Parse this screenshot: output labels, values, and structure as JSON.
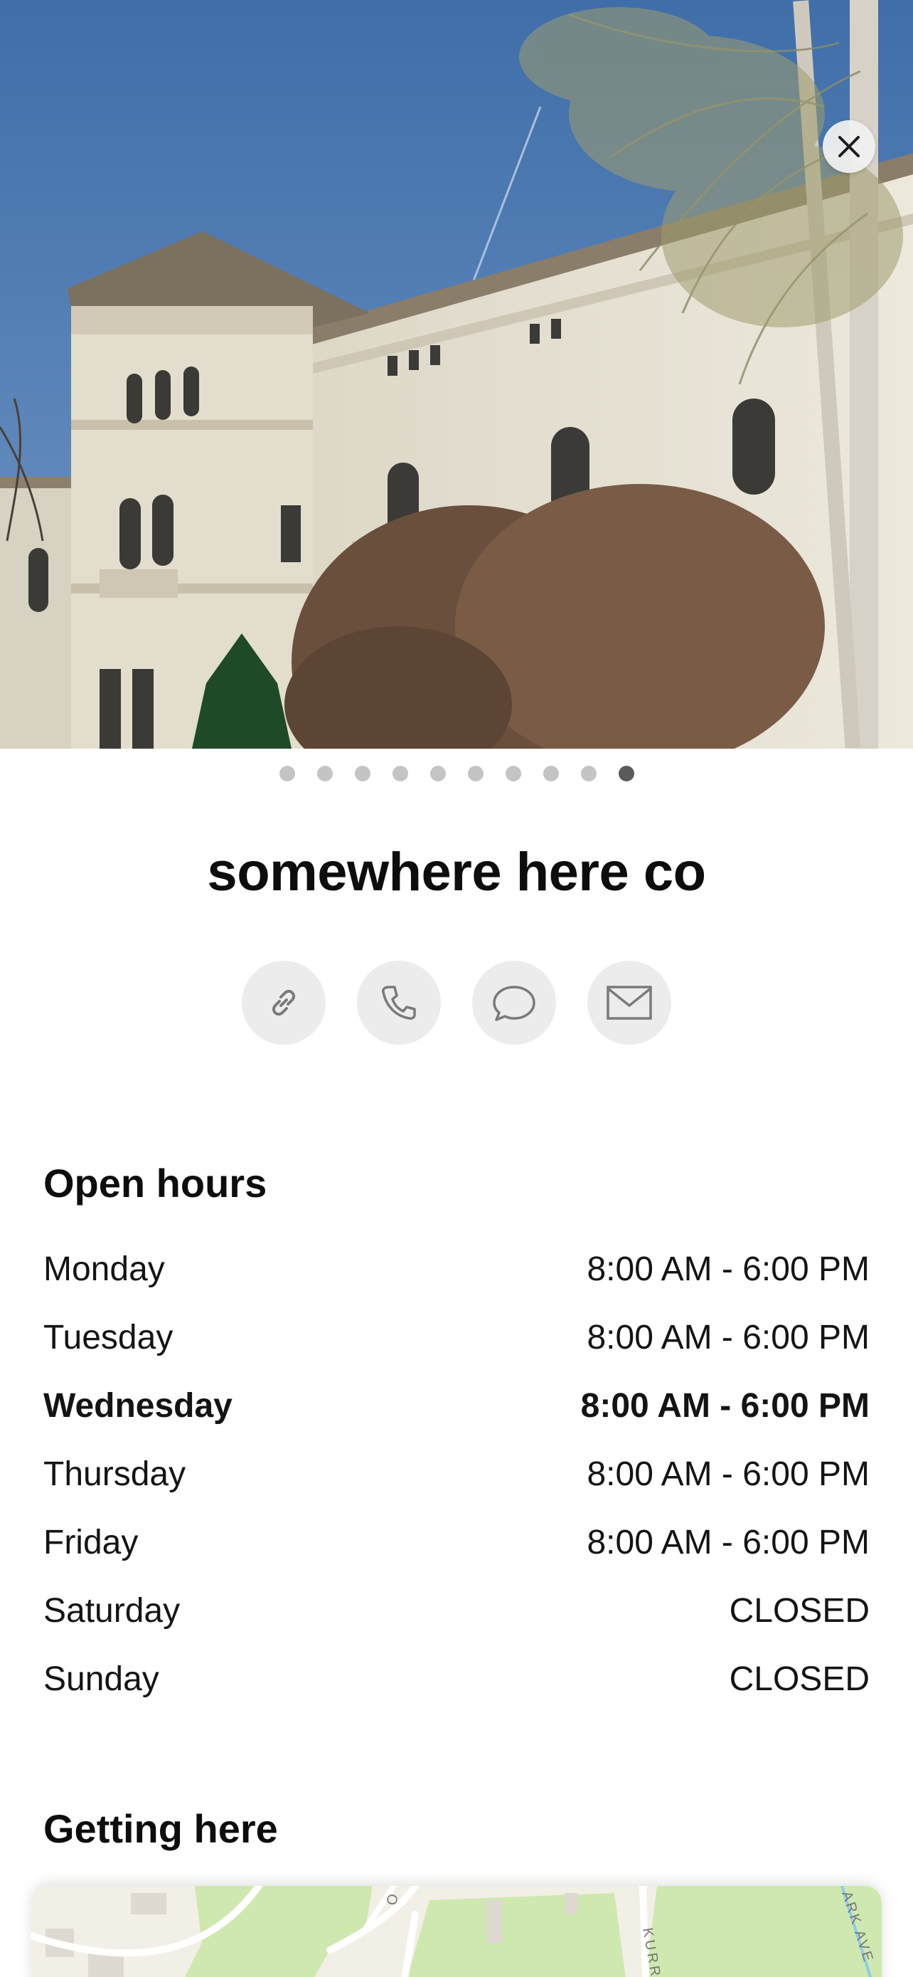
{
  "place": {
    "name": "somewhere here co"
  },
  "gallery": {
    "photo_count": 10,
    "active_index": 9
  },
  "actions": [
    {
      "icon": "link-icon"
    },
    {
      "icon": "phone-icon"
    },
    {
      "icon": "message-icon"
    },
    {
      "icon": "mail-icon"
    }
  ],
  "hours": {
    "title": "Open hours",
    "days": [
      {
        "day": "Monday",
        "time": "8:00 AM - 6:00 PM"
      },
      {
        "day": "Tuesday",
        "time": "8:00 AM - 6:00 PM"
      },
      {
        "day": "Wednesday",
        "time": "8:00 AM - 6:00 PM"
      },
      {
        "day": "Thursday",
        "time": "8:00 AM - 6:00 PM"
      },
      {
        "day": "Friday",
        "time": "8:00 AM - 6:00 PM"
      },
      {
        "day": "Saturday",
        "time": "CLOSED"
      },
      {
        "day": "Sunday",
        "time": "CLOSED"
      }
    ],
    "highlighted_day": "Wednesday"
  },
  "directions": {
    "title": "Getting here",
    "map_labels": [
      "KURR",
      "ARK AVE"
    ]
  },
  "colors": {
    "sky": "#4f7bb3",
    "building": "#e6e1d3",
    "map_park": "#cfe8b0",
    "map_land": "#f2efe6",
    "dot_active": "#5a5a5a",
    "dot_inactive": "#c4c4c4"
  }
}
